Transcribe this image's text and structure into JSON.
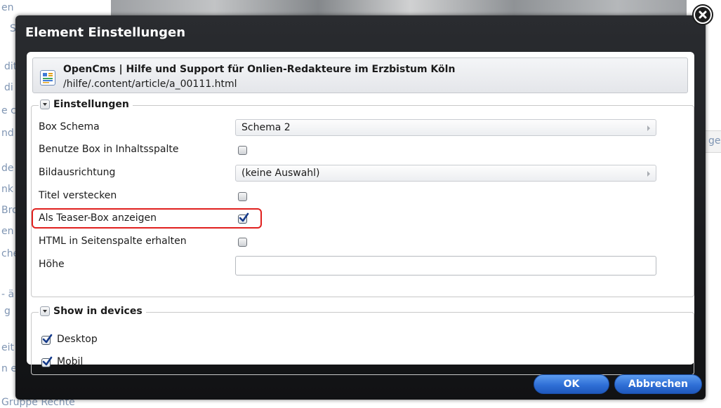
{
  "background": {
    "left_fragments": [
      "en",
      "S",
      "dit",
      "di",
      "e c",
      "nd",
      "de",
      "nk",
      "Bro",
      "en",
      "che",
      "- ä",
      "g",
      "eit",
      "n e"
    ],
    "right_fragment": "ge",
    "bottom_fragment": "Gruppe Rechte"
  },
  "dialog": {
    "title": "Element Einstellungen",
    "close_icon": "close-x-icon"
  },
  "resource": {
    "title": "OpenCms | Hilfe und Support für Onlien-Redakteure im Erzbistum Köln",
    "path": "/hilfe/.content/article/a_00111.html"
  },
  "settings": {
    "legend": "Einstellungen",
    "rows": [
      {
        "label": "Box Schema",
        "type": "select",
        "value": "Schema 2"
      },
      {
        "label": "Benutze Box in Inhaltsspalte",
        "type": "checkbox",
        "checked": false
      },
      {
        "label": "Bildausrichtung",
        "type": "select",
        "value": "(keine Auswahl)"
      },
      {
        "label": "Titel verstecken",
        "type": "checkbox",
        "checked": false
      },
      {
        "label": "Als Teaser-Box anzeigen",
        "type": "checkbox",
        "checked": true
      },
      {
        "label": "HTML in Seitenspalte erhalten",
        "type": "checkbox",
        "checked": false
      },
      {
        "label": "Höhe",
        "type": "text",
        "value": ""
      }
    ],
    "highlight_color": "#e0201e"
  },
  "devices": {
    "legend": "Show in devices",
    "items": [
      {
        "label": "Desktop",
        "checked": true
      },
      {
        "label": "Mobil",
        "checked": true
      }
    ]
  },
  "buttons": {
    "ok": "OK",
    "cancel": "Abbrechen"
  },
  "colors": {
    "accent": "#2f6fd6",
    "dialog_bg": "#1a1b1e"
  }
}
